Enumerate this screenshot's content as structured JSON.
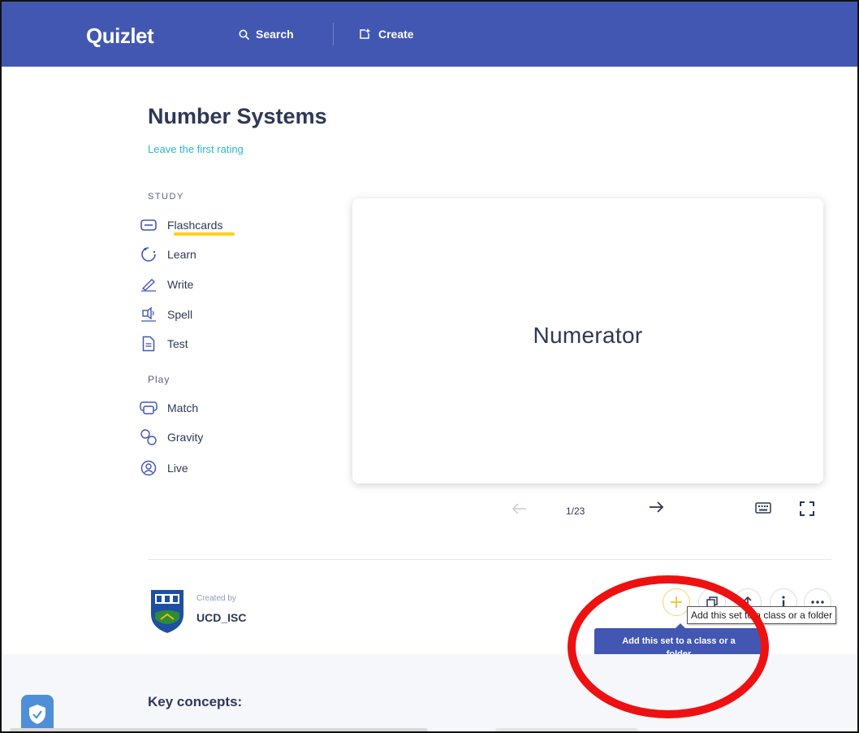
{
  "header": {
    "logo": "Quizlet",
    "search_label": "Search",
    "create_label": "Create"
  },
  "set": {
    "title": "Number Systems",
    "rating_link": "Leave the first rating"
  },
  "study": {
    "section_label": "STUDY",
    "modes": [
      {
        "label": "Flashcards",
        "icon": "flashcards-icon",
        "active": true
      },
      {
        "label": "Learn",
        "icon": "learn-icon"
      },
      {
        "label": "Write",
        "icon": "write-icon"
      },
      {
        "label": "Spell",
        "icon": "spell-icon"
      },
      {
        "label": "Test",
        "icon": "test-icon"
      }
    ]
  },
  "play": {
    "section_label": "Play",
    "modes": [
      {
        "label": "Match",
        "icon": "match-icon"
      },
      {
        "label": "Gravity",
        "icon": "gravity-icon"
      },
      {
        "label": "Live",
        "icon": "live-icon"
      }
    ]
  },
  "flashcard": {
    "term": "Numerator",
    "counter": "1/23"
  },
  "creator": {
    "created_by_label": "Created by",
    "username": "UCD_ISC"
  },
  "actions": {
    "native_tooltip": "Add this set to a class or a folder",
    "tooltip": "Add this set to a class or a folder"
  },
  "lower": {
    "key_concepts": "Key concepts:"
  },
  "colors": {
    "brand": "#4257b2",
    "accent_yellow": "#ffcd1f",
    "link_teal": "#2ab8c9",
    "annotation_red": "#ee1111"
  }
}
